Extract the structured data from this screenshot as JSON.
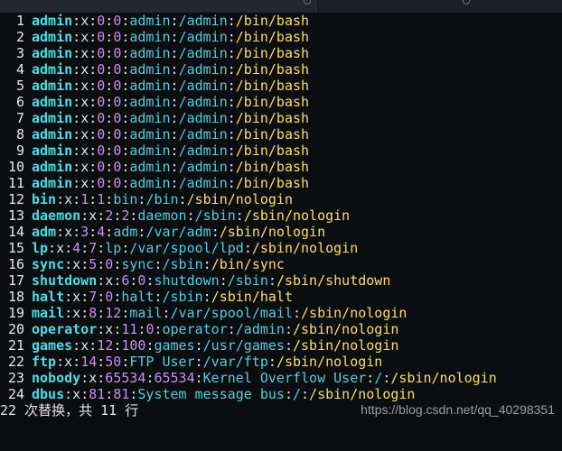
{
  "lines": [
    {
      "n": "1",
      "user": "admin",
      "x": "x",
      "uid": "0",
      "gid": "0",
      "gecos": "admin",
      "home": "/admin",
      "shell": "/bin/bash"
    },
    {
      "n": "2",
      "user": "admin",
      "x": "x",
      "uid": "0",
      "gid": "0",
      "gecos": "admin",
      "home": "/admin",
      "shell": "/bin/bash"
    },
    {
      "n": "3",
      "user": "admin",
      "x": "x",
      "uid": "0",
      "gid": "0",
      "gecos": "admin",
      "home": "/admin",
      "shell": "/bin/bash"
    },
    {
      "n": "4",
      "user": "admin",
      "x": "x",
      "uid": "0",
      "gid": "0",
      "gecos": "admin",
      "home": "/admin",
      "shell": "/bin/bash"
    },
    {
      "n": "5",
      "user": "admin",
      "x": "x",
      "uid": "0",
      "gid": "0",
      "gecos": "admin",
      "home": "/admin",
      "shell": "/bin/bash"
    },
    {
      "n": "6",
      "user": "admin",
      "x": "x",
      "uid": "0",
      "gid": "0",
      "gecos": "admin",
      "home": "/admin",
      "shell": "/bin/bash"
    },
    {
      "n": "7",
      "user": "admin",
      "x": "x",
      "uid": "0",
      "gid": "0",
      "gecos": "admin",
      "home": "/admin",
      "shell": "/bin/bash"
    },
    {
      "n": "8",
      "user": "admin",
      "x": "x",
      "uid": "0",
      "gid": "0",
      "gecos": "admin",
      "home": "/admin",
      "shell": "/bin/bash"
    },
    {
      "n": "9",
      "user": "admin",
      "x": "x",
      "uid": "0",
      "gid": "0",
      "gecos": "admin",
      "home": "/admin",
      "shell": "/bin/bash"
    },
    {
      "n": "10",
      "user": "admin",
      "x": "x",
      "uid": "0",
      "gid": "0",
      "gecos": "admin",
      "home": "/admin",
      "shell": "/bin/bash"
    },
    {
      "n": "11",
      "user": "admin",
      "x": "x",
      "uid": "0",
      "gid": "0",
      "gecos": "admin",
      "home": "/admin",
      "shell": "/bin/bash"
    },
    {
      "n": "12",
      "user": "bin",
      "x": "x",
      "uid": "1",
      "gid": "1",
      "gecos": "bin",
      "home": "/bin",
      "shell": "/sbin/nologin"
    },
    {
      "n": "13",
      "user": "daemon",
      "x": "x",
      "uid": "2",
      "gid": "2",
      "gecos": "daemon",
      "home": "/sbin",
      "shell": "/sbin/nologin"
    },
    {
      "n": "14",
      "user": "adm",
      "x": "x",
      "uid": "3",
      "gid": "4",
      "gecos": "adm",
      "home": "/var/adm",
      "shell": "/sbin/nologin"
    },
    {
      "n": "15",
      "user": "lp",
      "x": "x",
      "uid": "4",
      "gid": "7",
      "gecos": "lp",
      "home": "/var/spool/lpd",
      "shell": "/sbin/nologin"
    },
    {
      "n": "16",
      "user": "sync",
      "x": "x",
      "uid": "5",
      "gid": "0",
      "gecos": "sync",
      "home": "/sbin",
      "shell": "/bin/sync"
    },
    {
      "n": "17",
      "user": "shutdown",
      "x": "x",
      "uid": "6",
      "gid": "0",
      "gecos": "shutdown",
      "home": "/sbin",
      "shell": "/sbin/shutdown"
    },
    {
      "n": "18",
      "user": "halt",
      "x": "x",
      "uid": "7",
      "gid": "0",
      "gecos": "halt",
      "home": "/sbin",
      "shell": "/sbin/halt"
    },
    {
      "n": "19",
      "user": "mail",
      "x": "x",
      "uid": "8",
      "gid": "12",
      "gecos": "mail",
      "home": "/var/spool/mail",
      "shell": "/sbin/nologin"
    },
    {
      "n": "20",
      "user": "operator",
      "x": "x",
      "uid": "11",
      "gid": "0",
      "gecos": "operator",
      "home": "/admin",
      "shell": "/sbin/nologin"
    },
    {
      "n": "21",
      "user": "games",
      "x": "x",
      "uid": "12",
      "gid": "100",
      "gecos": "games",
      "home": "/usr/games",
      "shell": "/sbin/nologin"
    },
    {
      "n": "22",
      "user": "ftp",
      "x": "x",
      "uid": "14",
      "gid": "50",
      "gecos": "FTP User",
      "home": "/var/ftp",
      "shell": "/sbin/nologin"
    },
    {
      "n": "23",
      "user": "nobody",
      "x": "x",
      "uid": "65534",
      "gid": "65534",
      "gecos": "Kernel Overflow User",
      "home": "/",
      "shell": "/sbin/nologin"
    },
    {
      "n": "24",
      "user": "dbus",
      "x": "x",
      "uid": "81",
      "gid": "81",
      "gecos": "System message bus",
      "home": "/",
      "shell": "/sbin/nologin"
    }
  ],
  "separator": ":",
  "status": {
    "message": "22 次替换，共 11 行",
    "watermark": "https://blog.csdn.net/qq_40298351"
  },
  "colors": {
    "background": "#0b0d11",
    "username": "#47e0e6",
    "numbers": "#c792ea",
    "paths": "#4fd2d9",
    "shell": "#f5e063"
  }
}
